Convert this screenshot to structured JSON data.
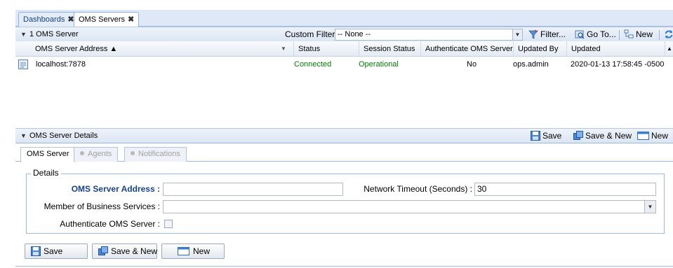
{
  "tabs": [
    {
      "label": "Dashboards",
      "close": "✖"
    },
    {
      "label": "OMS Servers",
      "close": "✖"
    }
  ],
  "list_panel": {
    "title": "1 OMS Server",
    "custom_filter_label": "Custom Filter",
    "custom_filter_value": "-- None --",
    "filter_label": "Filter...",
    "goto_label": "Go To...",
    "new_label": "New"
  },
  "grid": {
    "columns": [
      "OMS Server Address ▲",
      "Status",
      "Session Status",
      "Authenticate OMS Server",
      "Updated By",
      "Updated"
    ],
    "rows": [
      {
        "address": "localhost:7878",
        "status": "Connected",
        "session_status": "Operational",
        "authenticate": "No",
        "updated_by": "ops.admin",
        "updated": "2020-01-13 17:58:45 -0500"
      }
    ]
  },
  "details_panel": {
    "title": "OMS Server Details",
    "save_label": "Save",
    "save_new_label": "Save & New",
    "new_label": "New"
  },
  "subtabs": [
    "OMS Server",
    "Agents",
    "Notifications"
  ],
  "form": {
    "legend": "Details",
    "address_label": "OMS Server Address :",
    "address_value": "",
    "timeout_label": "Network Timeout (Seconds) :",
    "timeout_value": "30",
    "business_label": "Member of Business Services :",
    "business_value": "",
    "auth_label": "Authenticate OMS Server :",
    "auth_checked": false
  },
  "buttons": {
    "save": "Save",
    "save_new": "Save & New",
    "new": "New"
  }
}
